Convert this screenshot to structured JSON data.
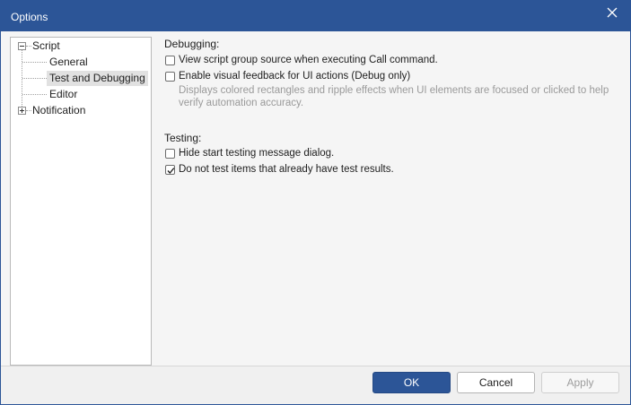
{
  "window": {
    "title": "Options",
    "close_icon": "close-icon"
  },
  "tree": {
    "items": [
      {
        "label": "Script",
        "expander": "minus",
        "level": 0
      },
      {
        "label": "General",
        "level": 1
      },
      {
        "label": "Test and Debugging",
        "level": 1,
        "selected": true
      },
      {
        "label": "Editor",
        "level": 1
      },
      {
        "label": "Notification",
        "expander": "plus",
        "level": 0
      }
    ]
  },
  "debugging": {
    "title": "Debugging:",
    "options": [
      {
        "label": "View script group source when executing Call command.",
        "checked": false
      },
      {
        "label": "Enable visual feedback for UI actions (Debug only)",
        "checked": false,
        "description": "Displays colored rectangles and ripple effects when UI elements are focused or clicked to help verify automation accuracy."
      }
    ]
  },
  "testing": {
    "title": "Testing:",
    "options": [
      {
        "label": "Hide start testing message dialog.",
        "checked": false
      },
      {
        "label": "Do not test items that already have test results.",
        "checked": true
      }
    ]
  },
  "buttons": {
    "ok": "OK",
    "cancel": "Cancel",
    "apply": "Apply",
    "apply_enabled": false
  },
  "colors": {
    "titlebar": "#2c5597",
    "primary_button": "#2c5597",
    "selection": "#e1e1e1"
  }
}
